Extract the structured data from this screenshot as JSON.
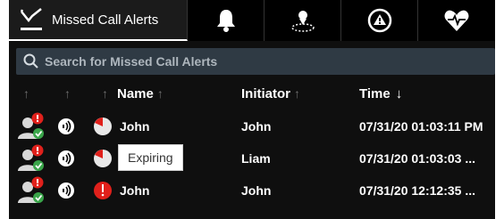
{
  "tabs": [
    {
      "label": "Missed Call Alerts",
      "icon": "missed-call-icon",
      "active": true
    },
    {
      "label": "",
      "icon": "bell-icon",
      "active": false
    },
    {
      "label": "",
      "icon": "location-icon",
      "active": false
    },
    {
      "label": "",
      "icon": "warning-icon",
      "active": false
    },
    {
      "label": "",
      "icon": "heartbeat-icon",
      "active": false
    }
  ],
  "search": {
    "placeholder": "Search for Missed Call Alerts",
    "value": ""
  },
  "columns": {
    "name": "Name",
    "initiator": "Initiator",
    "time": "Time"
  },
  "rows": [
    {
      "name": "John",
      "initiator": "John",
      "time": "07/31/20 01:03:11 PM",
      "status_icon": "expiring-timer-icon"
    },
    {
      "name": "",
      "initiator": "Liam",
      "time": "07/31/20 01:03:03 ...",
      "status_icon": "expiring-timer-icon"
    },
    {
      "name": "John",
      "initiator": "John",
      "time": "07/31/20 12:12:35 ...",
      "status_icon": "expired-alert-icon"
    }
  ],
  "tooltip": "Expiring",
  "colors": {
    "panel_bg": "#0f0f0f",
    "search_bg": "#2f3a44",
    "alert_red": "#e0201b",
    "ack_green": "#3aa54a"
  }
}
